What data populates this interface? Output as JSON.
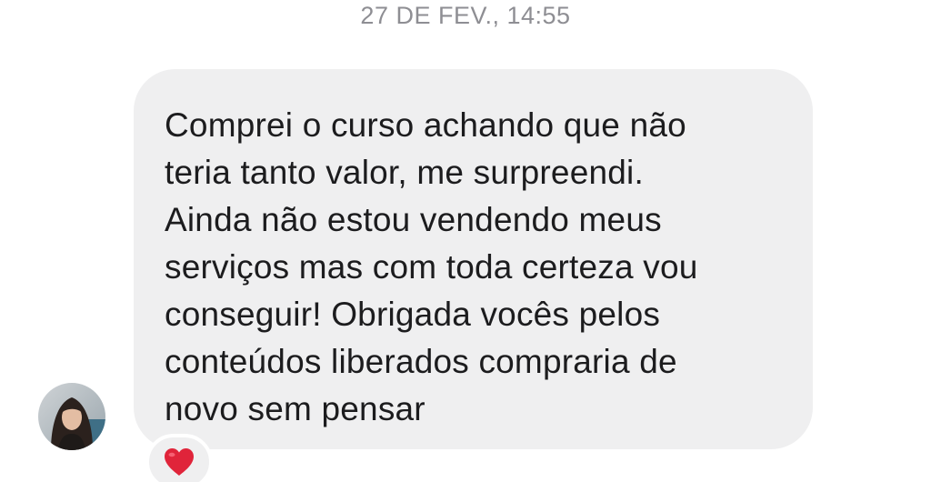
{
  "chat": {
    "timestamp": "27 DE FEV., 14:55",
    "message": {
      "lines": [
        "Comprei o curso achando que não",
        "teria tanto valor, me surpreendi.",
        "Ainda não estou vendendo meus",
        "serviços mas com toda certeza vou",
        "conseguir! Obrigada vocês pelos",
        "conteúdos liberados compraria de",
        "novo sem pensar"
      ],
      "bubble_color": "#efeff0",
      "text_color": "#1c1c1e"
    },
    "sender": {
      "avatar_icon": "user-avatar-photo"
    },
    "reaction": {
      "icon": "red-heart-icon",
      "color": "#e0243a"
    }
  }
}
